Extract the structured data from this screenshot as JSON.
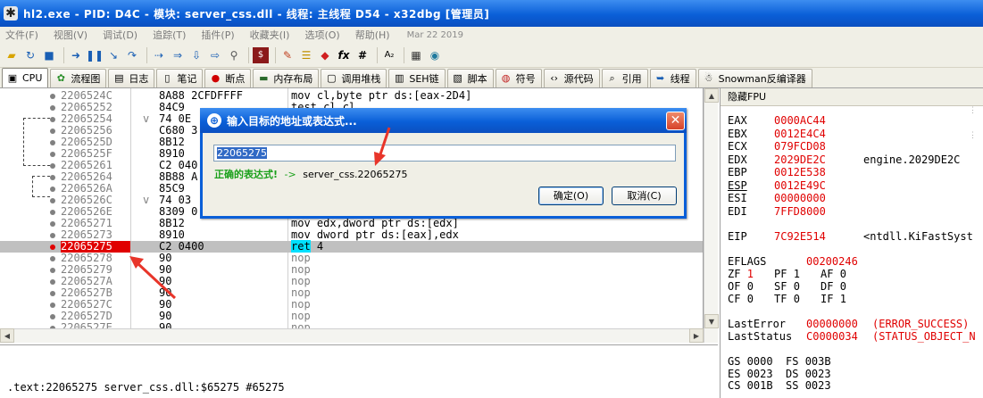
{
  "window": {
    "title": "hl2.exe - PID: D4C - 模块: server_css.dll - 线程: 主线程 D54 - x32dbg [管理员]"
  },
  "menu": {
    "items": [
      "文件(F)",
      "视图(V)",
      "调试(D)",
      "追踪(T)",
      "插件(P)",
      "收藏夹(I)",
      "选项(O)",
      "帮助(H)"
    ],
    "date": "Mar 22 2019"
  },
  "toolbar": {
    "icons": [
      "open-icon",
      "restart-icon",
      "stop-icon",
      "run-icon",
      "pause-icon",
      "step-into-icon",
      "step-over-icon",
      "trace-into-icon",
      "trace-over-icon",
      "execute-till-return-icon",
      "run-to-user-code-icon",
      "script-icon",
      "patch-icon",
      "comment-icon",
      "bookmark-icon",
      "function-icon",
      "hash-icon",
      "font-icon",
      "calculator-icon",
      "globe-icon"
    ],
    "fx": "fx",
    "hash": "#",
    "aa": "A₂"
  },
  "tabs": [
    {
      "label": "CPU",
      "icon": "cpu-icon",
      "active": true
    },
    {
      "label": "流程图",
      "icon": "graph-icon"
    },
    {
      "label": "日志",
      "icon": "log-icon"
    },
    {
      "label": "笔记",
      "icon": "notes-icon"
    },
    {
      "label": "断点",
      "icon": "breakpoint-icon"
    },
    {
      "label": "内存布局",
      "icon": "memory-map-icon"
    },
    {
      "label": "调用堆栈",
      "icon": "call-stack-icon"
    },
    {
      "label": "SEH链",
      "icon": "seh-icon"
    },
    {
      "label": "脚本",
      "icon": "script-icon"
    },
    {
      "label": "符号",
      "icon": "symbols-icon"
    },
    {
      "label": "源代码",
      "icon": "source-icon"
    },
    {
      "label": "引用",
      "icon": "references-icon"
    },
    {
      "label": "线程",
      "icon": "threads-icon"
    },
    {
      "label": "Snowman反编译器",
      "icon": "snowman-icon"
    }
  ],
  "disasm": {
    "rows": [
      {
        "addr": "2206524C",
        "mark": "",
        "bytes": "8A88 2CFDFFFF",
        "instr": "mov cl,byte ptr ds:[eax-2D4]"
      },
      {
        "addr": "22065252",
        "mark": "",
        "bytes": "84C9",
        "instr": "test cl,cl"
      },
      {
        "addr": "22065254",
        "mark": "v",
        "bytes": "74 0E",
        "instr": ""
      },
      {
        "addr": "22065256",
        "mark": "",
        "bytes": "C680 3",
        "instr": ""
      },
      {
        "addr": "2206525D",
        "mark": "",
        "bytes": "8B12",
        "instr": ""
      },
      {
        "addr": "2206525F",
        "mark": "",
        "bytes": "8910",
        "instr": ""
      },
      {
        "addr": "22065261",
        "mark": "",
        "bytes": "C2 040",
        "instr": ""
      },
      {
        "addr": "22065264",
        "mark": "",
        "bytes": "8B88 A",
        "instr": ""
      },
      {
        "addr": "2206526A",
        "mark": "",
        "bytes": "85C9",
        "instr": ""
      },
      {
        "addr": "2206526C",
        "mark": "v",
        "bytes": "74 03",
        "instr": ""
      },
      {
        "addr": "2206526E",
        "mark": "",
        "bytes": "8309 0",
        "instr": ""
      },
      {
        "addr": "22065271",
        "mark": "",
        "bytes": "8B12",
        "instr": "mov edx,dword ptr ds:[edx]"
      },
      {
        "addr": "22065273",
        "mark": "",
        "bytes": "8910",
        "instr": "mov dword ptr ds:[eax],edx"
      },
      {
        "addr": "22065275",
        "mark": "",
        "bytes": "C2 0400",
        "instr": "4",
        "ret": "ret",
        "selected": true
      },
      {
        "addr": "22065278",
        "mark": "",
        "bytes": "90",
        "instr": "nop"
      },
      {
        "addr": "22065279",
        "mark": "",
        "bytes": "90",
        "instr": "nop"
      },
      {
        "addr": "2206527A",
        "mark": "",
        "bytes": "90",
        "instr": "nop"
      },
      {
        "addr": "2206527B",
        "mark": "",
        "bytes": "90",
        "instr": "nop"
      },
      {
        "addr": "2206527C",
        "mark": "",
        "bytes": "90",
        "instr": "nop"
      },
      {
        "addr": "2206527D",
        "mark": "",
        "bytes": "90",
        "instr": "nop"
      },
      {
        "addr": "2206527E",
        "mark": "",
        "bytes": "90",
        "instr": "nop"
      }
    ]
  },
  "info": {
    "text": ".text:22065275 server_css.dll:$65275 #65275"
  },
  "regs": {
    "header": "隐藏FPU",
    "general": [
      {
        "name": "EAX",
        "value": "0000AC44",
        "comment": ""
      },
      {
        "name": "EBX",
        "value": "0012E4C4",
        "comment": ""
      },
      {
        "name": "ECX",
        "value": "079FCD08",
        "comment": ""
      },
      {
        "name": "EDX",
        "value": "2029DE2C",
        "comment": "engine.2029DE2C"
      },
      {
        "name": "EBP",
        "value": "0012E538",
        "comment": ""
      },
      {
        "name": "ESP",
        "value": "0012E49C",
        "comment": ""
      },
      {
        "name": "ESI",
        "value": "00000000",
        "comment": ""
      },
      {
        "name": "EDI",
        "value": "7FFD8000",
        "comment": ""
      }
    ],
    "eip": {
      "name": "EIP",
      "value": "7C92E514",
      "comment": "<ntdll.KiFastSyst"
    },
    "eflags": {
      "name": "EFLAGS",
      "value": "00200246"
    },
    "flags_rows": [
      [
        {
          "n": "ZF",
          "v": "1",
          "red": true
        },
        {
          "n": "PF",
          "v": "1"
        },
        {
          "n": "AF",
          "v": "0"
        }
      ],
      [
        {
          "n": "OF",
          "v": "0"
        },
        {
          "n": "SF",
          "v": "0"
        },
        {
          "n": "DF",
          "v": "0"
        }
      ],
      [
        {
          "n": "CF",
          "v": "0"
        },
        {
          "n": "TF",
          "v": "0"
        },
        {
          "n": "IF",
          "v": "1"
        }
      ]
    ],
    "last_error": {
      "name": "LastError",
      "value": "00000000",
      "comment": "(ERROR_SUCCESS)"
    },
    "last_status": {
      "name": "LastStatus",
      "value": "C0000034",
      "comment": "(STATUS_OBJECT_N"
    },
    "segments": [
      "GS 0000  FS 003B",
      "ES 0023  DS 0023",
      "CS 001B  SS 0023"
    ]
  },
  "dialog": {
    "title": "输入目标的地址或表达式...",
    "input_value": "22065275",
    "status_ok": "正确的表达式!",
    "status_arrow": "->",
    "status_result": "server_css.22065275",
    "ok_label": "确定(O)",
    "cancel_label": "取消(C)"
  },
  "colors": {
    "accent_blue": "#0a5fd8",
    "breakpoint_red": "#e00000",
    "ok_green": "#1aa01a",
    "ret_cyan": "#00e0ff"
  }
}
